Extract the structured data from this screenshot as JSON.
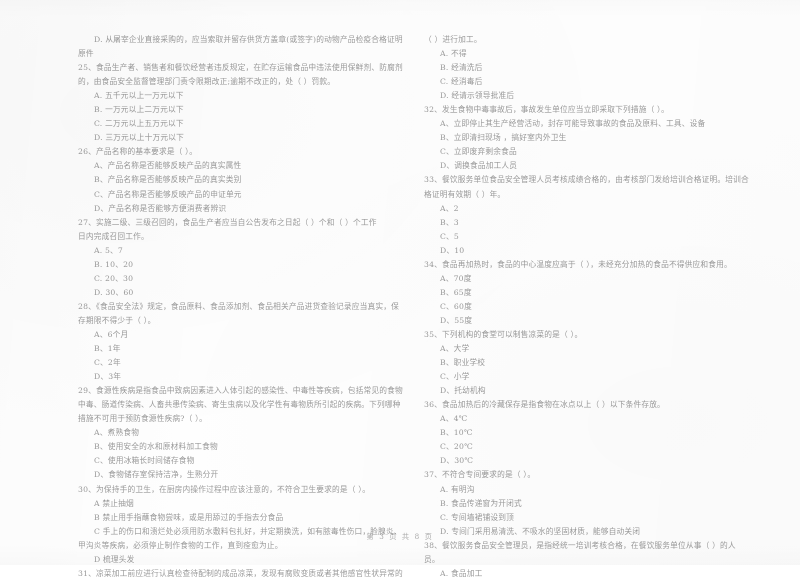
{
  "document": {
    "type": "scanned-exam-paper",
    "language": "zh-CN",
    "footer": "第 3 页 共 8 页",
    "ink_color": "#8b8b8b",
    "paper_color": "#fefefe"
  },
  "left_column": {
    "lines": [
      {
        "role": "option",
        "text": "D. 从屠宰企业直接采购的，应当索取并留存供货方盖章(或签字)的动物产品检疫合格证明"
      },
      {
        "role": "cont",
        "text": "原件"
      },
      {
        "role": "question",
        "text": "25、食品生产者、销售者和餐饮经营者违反规定，在贮存运输食品中违法使用保鲜剂、防腐剂"
      },
      {
        "role": "cont",
        "text": "的，由食品安全监督管理部门责令限期改正;逾期不改正的，处（       ）罚款。"
      },
      {
        "role": "option",
        "text": "A. 五千元以上一万元以下"
      },
      {
        "role": "option",
        "text": "B. 一万元以上二万元以下"
      },
      {
        "role": "option",
        "text": "C. 二万元以上五万元以下"
      },
      {
        "role": "option",
        "text": "D. 三万元以上十万元以下"
      },
      {
        "role": "question",
        "text": "26、产品名称的基本要求是（      ）。"
      },
      {
        "role": "option",
        "text": "A、产品名称是否能够反映产品的真实属性"
      },
      {
        "role": "option",
        "text": "B、产品名称是否能够反映产品的真实类别"
      },
      {
        "role": "option",
        "text": "C、产品名称是否能够反映产品的申证单元"
      },
      {
        "role": "option",
        "text": "D、产品名称是否能够方便消费者辨识"
      },
      {
        "role": "question",
        "text": "27、实施二级、三级召回的，食品生产者应当自公告发布之日起（      ）个和（      ）个工作"
      },
      {
        "role": "cont",
        "text": "日内完成召回工作。"
      },
      {
        "role": "option",
        "text": "A. 5、7"
      },
      {
        "role": "option",
        "text": "B. 10、20"
      },
      {
        "role": "option",
        "text": "C. 20、30"
      },
      {
        "role": "option",
        "text": "D. 30、60"
      },
      {
        "role": "question",
        "text": "28、《食品安全法》规定，食品原料、食品添加剂、食品相关产品进货查验记录应当真实，保"
      },
      {
        "role": "cont",
        "text": "存期限不得少于（      ）。"
      },
      {
        "role": "option",
        "text": "A、6个月"
      },
      {
        "role": "option",
        "text": "B、1年"
      },
      {
        "role": "option",
        "text": "C、2年"
      },
      {
        "role": "option",
        "text": "D、3年"
      },
      {
        "role": "question",
        "text": "29、食源性疾病是指食品中致病因素进入人体引起的感染性、中毒性等疾病，包括常见的食物"
      },
      {
        "role": "cont",
        "text": "中毒、肠道传染病、人畜共患传染病、寄生虫病以及化学性有毒物质所引起的疾病。下列哪种"
      },
      {
        "role": "cont",
        "text": "措施不可用于预防食源性疾病?（       ）。"
      },
      {
        "role": "option",
        "text": "A、煮熟食物"
      },
      {
        "role": "option",
        "text": "B、使用安全的水和原材料加工食物"
      },
      {
        "role": "option",
        "text": "C、使用冰箱长时间储存食物"
      },
      {
        "role": "option",
        "text": "D、食物储存室保持洁净，生熟分开"
      },
      {
        "role": "question",
        "text": "30、为保持手的卫生，在厨房内操作过程中应该注意的，不符合卫生要求的是（       ）。"
      },
      {
        "role": "option",
        "text": "A 禁止抽烟"
      },
      {
        "role": "option",
        "text": "B 禁止用手指蘸食物尝味，或是用舔过的手指去分食品"
      },
      {
        "role": "option",
        "text": "C  手上的伤口和溃烂处必须用防水敷料包扎好，并定期换洗，如有脓毒性伤口，脸腺炎、"
      },
      {
        "role": "cont",
        "text": "甲沟炎等疾病，必须停止制作食物的工作，直到痊愈为止。"
      },
      {
        "role": "option",
        "text": "D 梳理头发"
      },
      {
        "role": "question",
        "text": "31、凉菜加工前应进行认真检查待配制的成品凉菜，发现有腐败变质或者其他感官性状异常的"
      }
    ]
  },
  "right_column": {
    "lines": [
      {
        "role": "cont",
        "text": "（       ）进行加工。"
      },
      {
        "role": "option",
        "text": "A. 不得"
      },
      {
        "role": "option",
        "text": "B. 经清洗后"
      },
      {
        "role": "option",
        "text": "C. 经消毒后"
      },
      {
        "role": "option",
        "text": "D. 经请示领导批准后"
      },
      {
        "role": "question",
        "text": "32、发生食物中毒事故后，事故发生单位应当立即采取下列措施（       ）。"
      },
      {
        "role": "option",
        "text": "A、立即停止其生产经营活动，封存可能导致事故的食品及原料、工具、设备"
      },
      {
        "role": "option",
        "text": "B、立即清扫现场 ，搞好室内外卫生"
      },
      {
        "role": "option",
        "text": "C、立即废弃剩余食品"
      },
      {
        "role": "option",
        "text": "D、调换食品加工人员"
      },
      {
        "role": "question",
        "text": "33、餐饮服务单位食品安全管理人员考核成绩合格的，由考核部门发给培训合格证明。培训合"
      },
      {
        "role": "cont",
        "text": "格证明有效期（      ）年。"
      },
      {
        "role": "option",
        "text": "A、2"
      },
      {
        "role": "option",
        "text": "B、3"
      },
      {
        "role": "option",
        "text": "C、5"
      },
      {
        "role": "option",
        "text": "D、10"
      },
      {
        "role": "question",
        "text": "34、食品再加热时，食品的中心温度应高于（       ），未经充分加热的食品不得供应和食用。"
      },
      {
        "role": "option",
        "text": "A、70度"
      },
      {
        "role": "option",
        "text": "B、65度"
      },
      {
        "role": "option",
        "text": "C、60度"
      },
      {
        "role": "option",
        "text": "D、55度"
      },
      {
        "role": "question",
        "text": "35、下列机构的食堂可以制售凉菜的是（       ）。"
      },
      {
        "role": "option",
        "text": "A、大学"
      },
      {
        "role": "option",
        "text": "B、职业学校"
      },
      {
        "role": "option",
        "text": "C、小学"
      },
      {
        "role": "option",
        "text": "D、托幼机构"
      },
      {
        "role": "question",
        "text": "36、食品加热后的冷藏保存是指食物在冰点以上（       ）以下条件存放。"
      },
      {
        "role": "option",
        "text": "A、4℃"
      },
      {
        "role": "option",
        "text": "B、10℃"
      },
      {
        "role": "option",
        "text": "C、20℃"
      },
      {
        "role": "option",
        "text": "D、30℃"
      },
      {
        "role": "question",
        "text": "37、不符合专间要求的是（       ）。"
      },
      {
        "role": "option",
        "text": "A. 有明沟"
      },
      {
        "role": "option",
        "text": "B. 食品传递窗为开闭式"
      },
      {
        "role": "option",
        "text": "C. 专间墙裙铺设到顶"
      },
      {
        "role": "option",
        "text": "D. 专间门采用易清洗、不吸水的坚固材质，能够自动关闭"
      },
      {
        "role": "question",
        "text": "38、餐饮服务食品安全管理员，是指经统一培训考核合格，在餐饮服务单位从事（       ）的人"
      },
      {
        "role": "cont",
        "text": "员。"
      },
      {
        "role": "option",
        "text": "A. 食品加工"
      }
    ]
  }
}
